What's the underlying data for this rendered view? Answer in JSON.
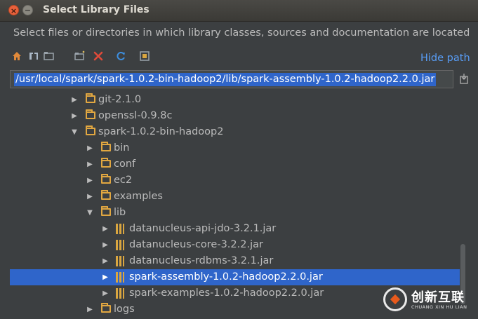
{
  "window": {
    "title": "Select Library Files",
    "close_glyph": "×",
    "minimize_glyph": "−"
  },
  "description": "Select files or directories in which library classes, sources and documentation are located",
  "toolbar": {
    "icons": [
      "home-icon",
      "project-icon",
      "module-icon",
      "new-folder-icon",
      "delete-icon",
      "refresh-icon",
      "show-hidden-icon"
    ],
    "hide_path_label": "Hide path"
  },
  "path": {
    "value": "/usr/local/spark/spark-1.0.2-bin-hadoop2/lib/spark-assembly-1.0.2-hadoop2.2.0.jar"
  },
  "tree": {
    "rows": [
      {
        "label": "git-2.1.0",
        "type": "folder",
        "expanded": false,
        "level": 0,
        "selected": false
      },
      {
        "label": "openssl-0.9.8c",
        "type": "folder",
        "expanded": false,
        "level": 0,
        "selected": false
      },
      {
        "label": "spark-1.0.2-bin-hadoop2",
        "type": "folder",
        "expanded": true,
        "level": 0,
        "selected": false
      },
      {
        "label": "bin",
        "type": "folder",
        "expanded": false,
        "level": 1,
        "selected": false
      },
      {
        "label": "conf",
        "type": "folder",
        "expanded": false,
        "level": 1,
        "selected": false
      },
      {
        "label": "ec2",
        "type": "folder",
        "expanded": false,
        "level": 1,
        "selected": false
      },
      {
        "label": "examples",
        "type": "folder",
        "expanded": false,
        "level": 1,
        "selected": false
      },
      {
        "label": "lib",
        "type": "folder",
        "expanded": true,
        "level": 1,
        "selected": false
      },
      {
        "label": "datanucleus-api-jdo-3.2.1.jar",
        "type": "jar",
        "expanded": false,
        "level": 2,
        "selected": false
      },
      {
        "label": "datanucleus-core-3.2.2.jar",
        "type": "jar",
        "expanded": false,
        "level": 2,
        "selected": false
      },
      {
        "label": "datanucleus-rdbms-3.2.1.jar",
        "type": "jar",
        "expanded": false,
        "level": 2,
        "selected": false
      },
      {
        "label": "spark-assembly-1.0.2-hadoop2.2.0.jar",
        "type": "jar",
        "expanded": false,
        "level": 2,
        "selected": true
      },
      {
        "label": "spark-examples-1.0.2-hadoop2.2.0.jar",
        "type": "jar",
        "expanded": false,
        "level": 2,
        "selected": false
      },
      {
        "label": "logs",
        "type": "folder",
        "expanded": false,
        "level": 1,
        "selected": false
      }
    ]
  },
  "watermark": {
    "name": "创新互联",
    "subtitle": "CHUANG XIN HU LIAN"
  },
  "colors": {
    "background": "#3c3f41",
    "selection": "#2f65ca",
    "link": "#589df6",
    "folder": "#e1a741",
    "delete": "#e04a3a",
    "refresh": "#3d8fe0"
  }
}
